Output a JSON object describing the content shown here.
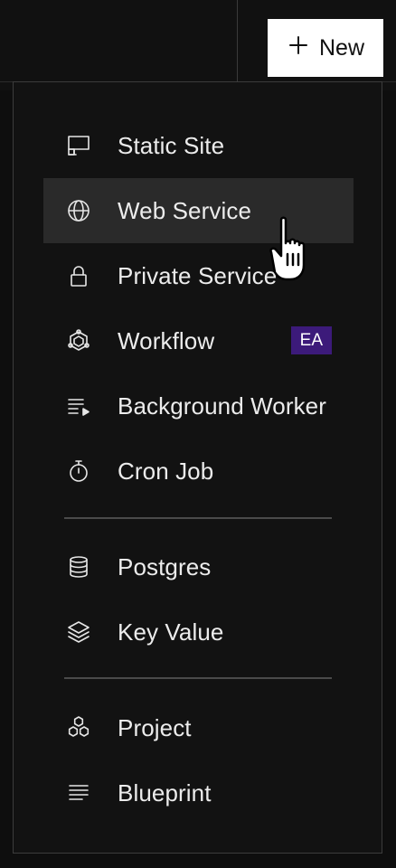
{
  "header": {
    "new_button_label": "New"
  },
  "menu": {
    "items": [
      {
        "key": "static_site",
        "label": "Static Site",
        "icon": "monitor-icon"
      },
      {
        "key": "web_service",
        "label": "Web Service",
        "icon": "globe-icon",
        "active": true
      },
      {
        "key": "private_service",
        "label": "Private Service",
        "icon": "lock-icon"
      },
      {
        "key": "workflow",
        "label": "Workflow",
        "icon": "workflow-icon",
        "badge": "EA"
      },
      {
        "key": "background_worker",
        "label": "Background Worker",
        "icon": "list-play-icon"
      },
      {
        "key": "cron_job",
        "label": "Cron Job",
        "icon": "stopwatch-icon"
      },
      {
        "key": "postgres",
        "label": "Postgres",
        "icon": "database-icon"
      },
      {
        "key": "key_value",
        "label": "Key Value",
        "icon": "layers-icon"
      },
      {
        "key": "project",
        "label": "Project",
        "icon": "hexagons-icon"
      },
      {
        "key": "blueprint",
        "label": "Blueprint",
        "icon": "lines-icon"
      }
    ]
  },
  "colors": {
    "background": "#121212",
    "active_item": "#2a2a2a",
    "badge_bg": "#3c1a7a",
    "button_bg": "#ffffff"
  }
}
